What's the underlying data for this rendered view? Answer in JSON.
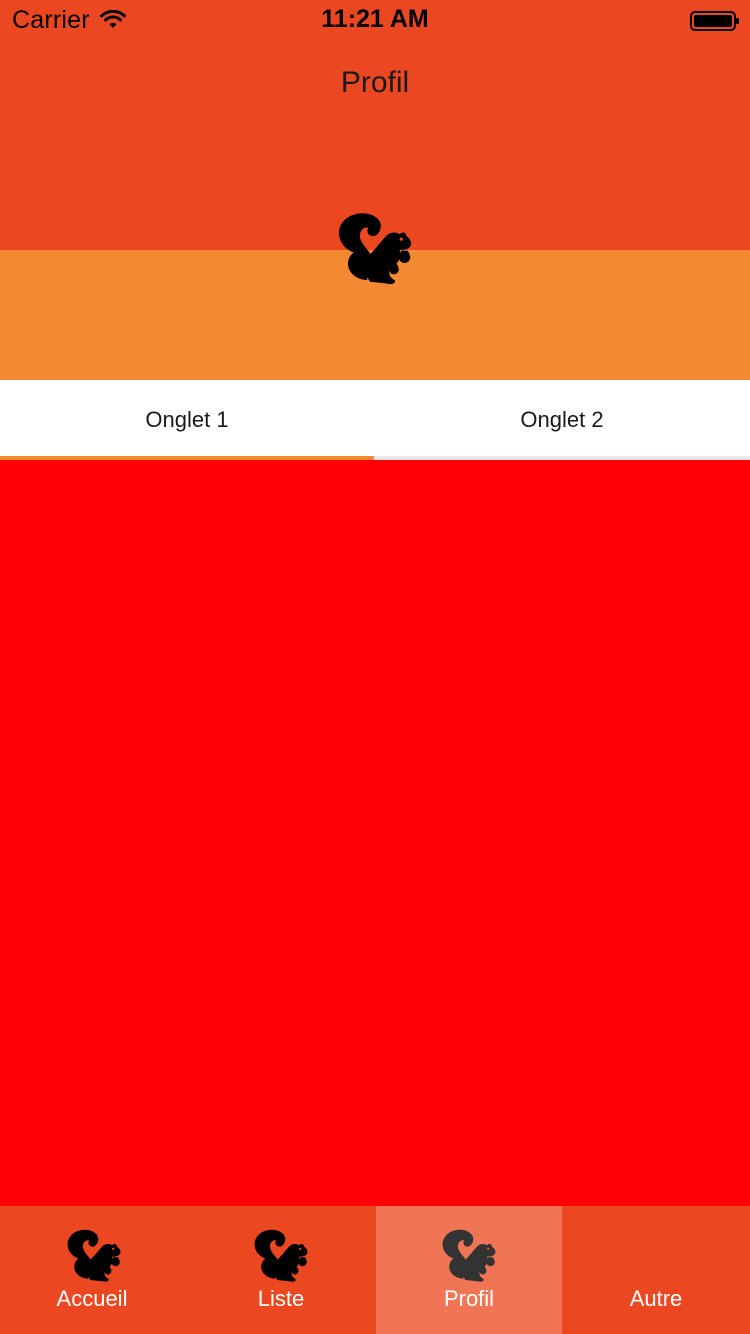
{
  "status_bar": {
    "carrier": "Carrier",
    "time": "11:21 AM"
  },
  "header": {
    "title": "Profil"
  },
  "tabs": [
    {
      "label": "Onglet 1",
      "selected": true
    },
    {
      "label": "Onglet 2",
      "selected": false
    }
  ],
  "bottom_nav": {
    "items": [
      {
        "label": "Accueil",
        "icon": "squirrel-icon",
        "active": false
      },
      {
        "label": "Liste",
        "icon": "squirrel-icon",
        "active": false
      },
      {
        "label": "Profil",
        "icon": "squirrel-icon",
        "active": true
      },
      {
        "label": "Autre",
        "icon": "",
        "active": false
      }
    ]
  },
  "colors": {
    "header": "#EB4720",
    "band": "#F58931",
    "content": "#FF0007",
    "nav_active": "#F07555",
    "tab_indicator": "#F58931"
  }
}
